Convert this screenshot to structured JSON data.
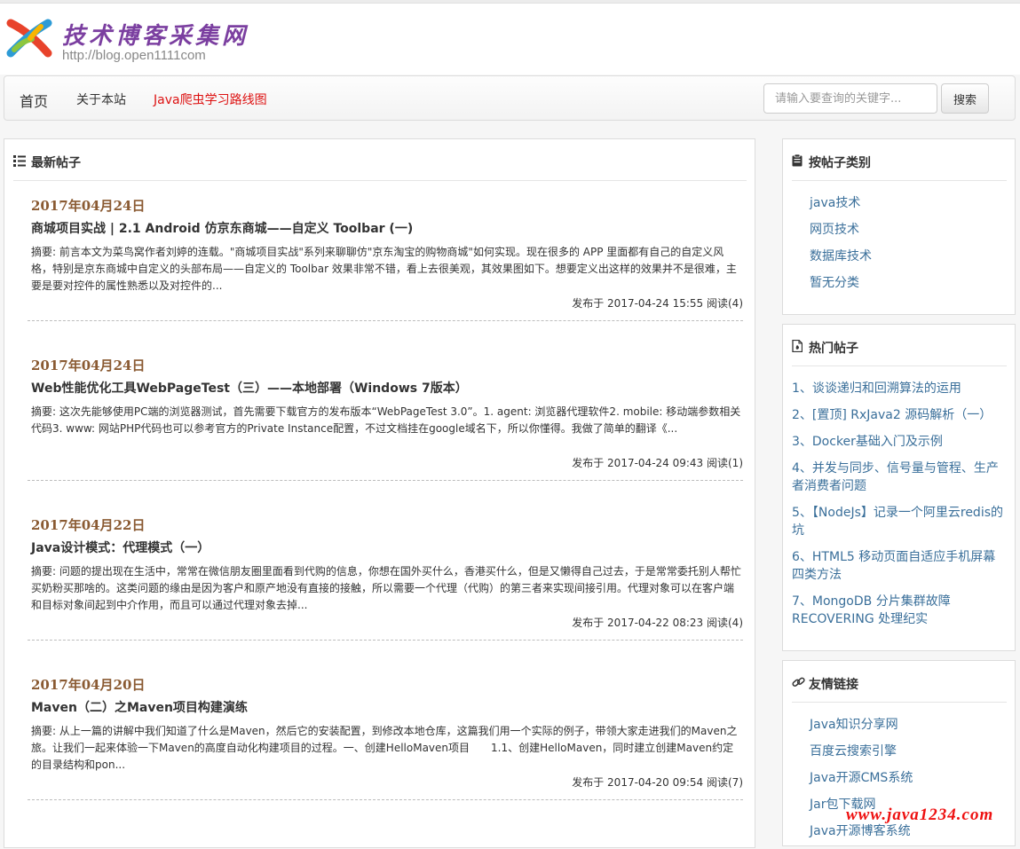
{
  "header": {
    "site_title": "技术博客采集网",
    "site_url": "http://blog.open1111com"
  },
  "nav": {
    "home": "首页",
    "about": "关于本站",
    "route": "Java爬虫学习路线图",
    "search_placeholder": "请输入要查询的关键字...",
    "search_button": "搜索"
  },
  "main": {
    "heading": "最新帖子",
    "posts": [
      {
        "date": "2017年04月24日",
        "title": "商城项目实战 | 2.1 Android 仿京东商城——自定义 Toolbar (一)",
        "summary": "摘要: 前言本文为菜鸟窝作者刘婷的连载。\"商城项目实战\"系列来聊聊仿\"京东淘宝的购物商城\"如何实现。现在很多的 APP 里面都有自己的自定义风格，特别是京东商城中自定义的头部布局——自定义的 Toolbar 效果非常不错，看上去很美观，其效果图如下。想要定义出这样的效果并不是很难，主要是要对控件的属性熟悉以及对控件的...",
        "meta": "发布于 2017-04-24 15:55 阅读(4)"
      },
      {
        "date": "2017年04月24日",
        "title": "Web性能优化工具WebPageTest（三）——本地部署（Windows 7版本）",
        "summary": "摘要: 这次先能够使用PC端的浏览器测试，首先需要下载官方的发布版本“WebPageTest 3.0”。1. agent: 浏览器代理软件2. mobile: 移动端参数相关代码3. www: 网站PHP代码也可以参考官方的Private Instance配置，不过文档挂在google域名下，所以你懂得。我做了简单的翻译《...",
        "meta": "发布于 2017-04-24 09:43 阅读(1)"
      },
      {
        "date": "2017年04月22日",
        "title": "Java设计模式：代理模式（一）",
        "summary": "摘要: 问题的提出现在生活中，常常在微信朋友圈里面看到代购的信息，你想在国外买什么，香港买什么，但是又懒得自己过去，于是常常委托别人帮忙买奶粉买那啥的。这类问题的缘由是因为客户和原产地没有直接的接触，所以需要一个代理（代购）的第三者来实现间接引用。代理对象可以在客户端和目标对象间起到中介作用，而且可以通过代理对象去掉...",
        "meta": "发布于 2017-04-22 08:23 阅读(4)"
      },
      {
        "date": "2017年04月20日",
        "title": "Maven（二）之Maven项目构建演练",
        "summary": "摘要: 从上一篇的讲解中我们知道了什么是Maven，然后它的安装配置，到修改本地仓库，这篇我们用一个实际的例子，带领大家走进我们的Maven之旅。让我们一起来体验一下Maven的高度自动化构建项目的过程。一、创建HelloMaven项目　　1.1、创建HelloMaven，同时建立创建Maven约定的目录结构和pon...",
        "meta": "发布于 2017-04-20 09:54 阅读(7)"
      }
    ]
  },
  "sidebar": {
    "categories": {
      "heading": "按帖子类别",
      "items": [
        "java技术",
        "网页技术",
        "数据库技术",
        "暂无分类"
      ]
    },
    "hot": {
      "heading": "热门帖子",
      "items": [
        "1、谈谈递归和回溯算法的运用",
        "2、[置顶] RxJava2 源码解析（一）",
        "3、Docker基础入门及示例",
        "4、并发与同步、信号量与管程、生产者消费者问题",
        "5、【NodeJs】记录一个阿里云redis的坑",
        "6、HTML5 移动页面自适应手机屏幕四类方法",
        "7、MongoDB 分片集群故障RECOVERING 处理纪实"
      ]
    },
    "links": {
      "heading": "友情链接",
      "items": [
        "Java知识分享网",
        "百度云搜索引擎",
        "Java开源CMS系统",
        "Jar包下载网",
        "Java开源博客系统"
      ]
    }
  },
  "watermark": "www.java1234.com",
  "colors": {
    "title_purple": "#7b3fa0",
    "date_brown": "#8a5a32",
    "link_blue": "#3a6f9a",
    "accent_red": "#dd1111"
  }
}
